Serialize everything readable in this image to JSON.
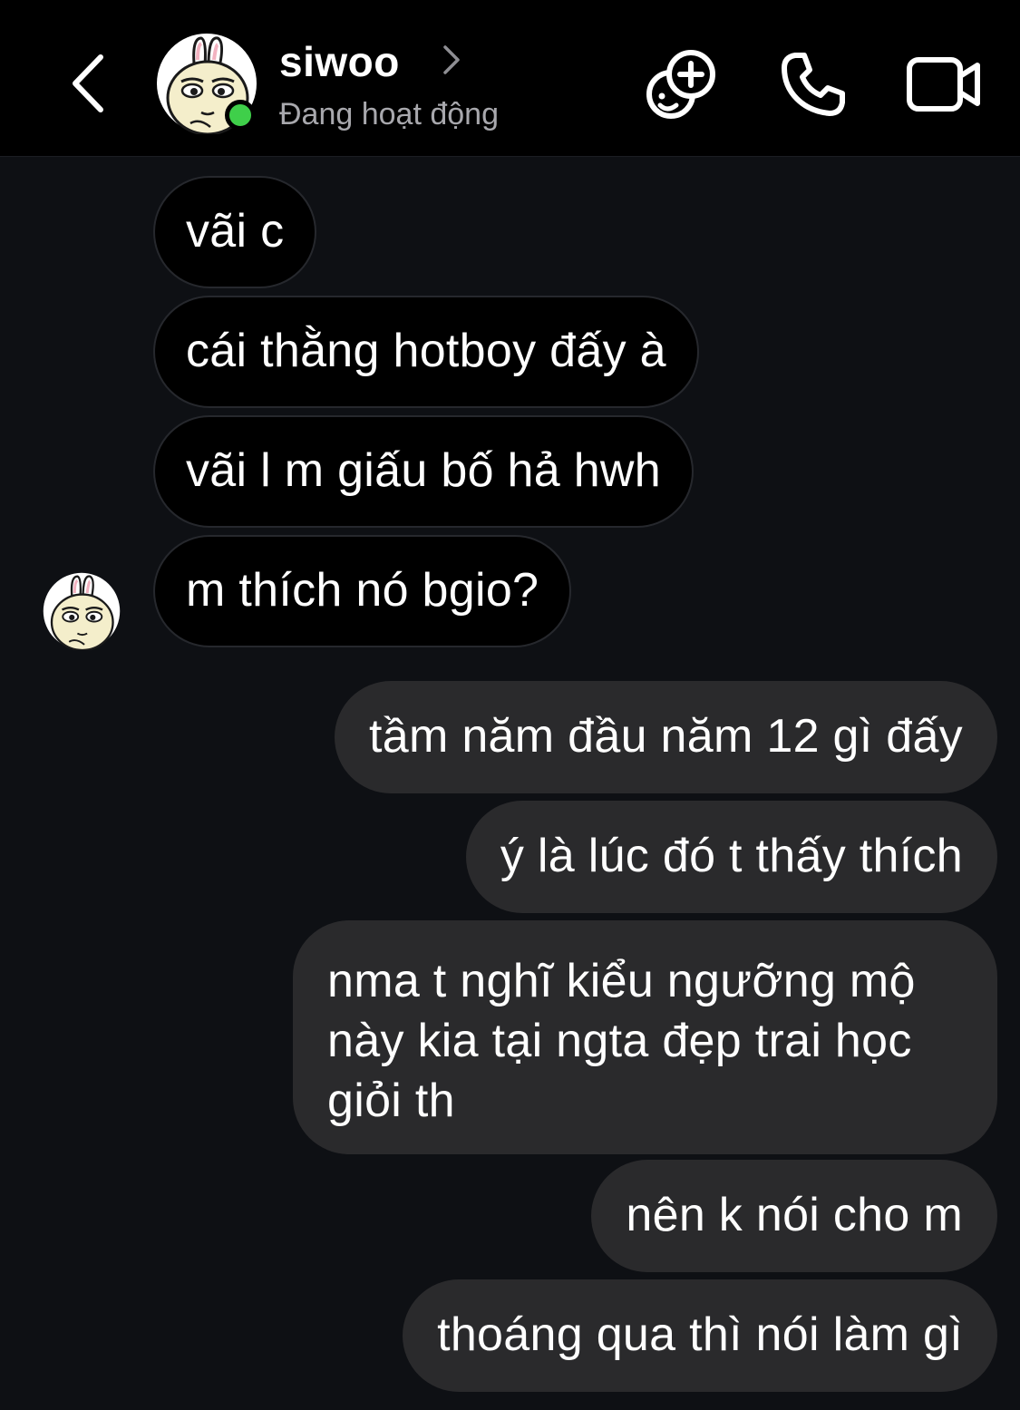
{
  "header": {
    "name": "siwoo",
    "status": "Đang hoạt động",
    "online_color": "#3fcf4a",
    "icons": {
      "back": "chevron-left-icon",
      "name_chevron": "chevron-right-icon",
      "effects": "add-effect-icon",
      "call": "phone-icon",
      "video": "video-camera-icon"
    }
  },
  "messages": {
    "incoming": [
      "vãi c",
      "cái thằng hotboy đấy à",
      "vãi l m giấu bố hả hwh",
      "m thích nó bgio?"
    ],
    "outgoing": [
      "tầm năm đầu năm 12 gì đấy",
      "ý là lúc đó t thấy thích",
      "nma t nghĩ kiểu ngưỡng mộ\nnày kia tại ngta đẹp trai học\ngiỏi th",
      "nên k nói cho m",
      "thoáng qua thì nói làm gì"
    ]
  },
  "colors": {
    "header_bg": "#000000",
    "chat_bg": "#0e1014",
    "incoming_bubble": "#000000",
    "outgoing_bubble": "#2a2a2c",
    "text": "#ffffff",
    "status_text": "#a8a8ad"
  }
}
